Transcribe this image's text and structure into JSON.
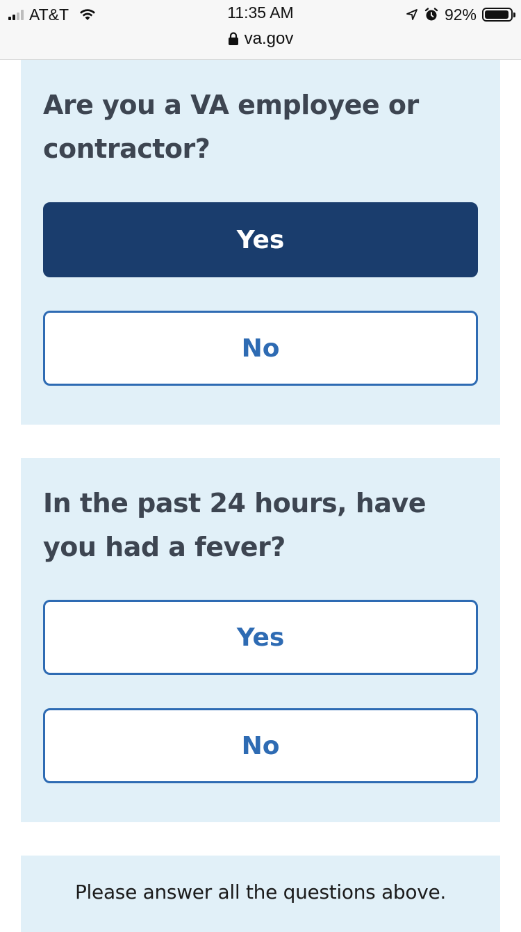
{
  "status_bar": {
    "carrier": "AT&T",
    "time": "11:35 AM",
    "url": "va.gov",
    "battery_percent": "92%",
    "battery_level": 0.92,
    "signal_bars": 2,
    "icons": [
      "signal-icon",
      "wifi-icon",
      "lock-icon",
      "location-arrow-icon",
      "alarm-icon",
      "battery-icon"
    ]
  },
  "questions": [
    {
      "text": "Are you a VA employee or contractor?",
      "yes_label": "Yes",
      "no_label": "No",
      "selected": "Yes"
    },
    {
      "text": "In the past 24 hours, have you had a fever?",
      "yes_label": "Yes",
      "no_label": "No",
      "selected": null
    }
  ],
  "notice": "Please answer all the questions above.",
  "colors": {
    "card_background": "#e1f0f8",
    "selected_button": "#1a3d6d",
    "outline_button": "#2e6bb3",
    "question_text": "#3d4551"
  }
}
